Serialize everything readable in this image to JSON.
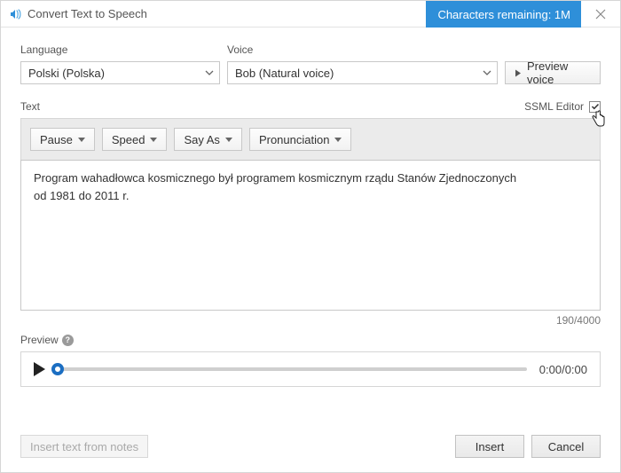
{
  "window": {
    "title": "Convert Text to Speech",
    "characters_remaining_label": "Characters remaining: 1M"
  },
  "language": {
    "label": "Language",
    "value": "Polski (Polska)"
  },
  "voice": {
    "label": "Voice",
    "value": "Bob (Natural voice)",
    "preview_button": "Preview voice"
  },
  "text_section": {
    "label": "Text",
    "ssml_editor_label": "SSML Editor",
    "ssml_checked": true,
    "content": "Program wahadłowca kosmicznego był programem kosmicznym rządu Stanów Zjednoczonych\nod 1981 do 2011 r.",
    "counter": "190/4000"
  },
  "toolbar": {
    "pause": "Pause",
    "speed": "Speed",
    "say_as": "Say As",
    "pronunciation": "Pronunciation"
  },
  "preview": {
    "label": "Preview",
    "time": "0:00/0:00"
  },
  "footer": {
    "insert_from_notes": "Insert text from notes",
    "insert": "Insert",
    "cancel": "Cancel"
  }
}
